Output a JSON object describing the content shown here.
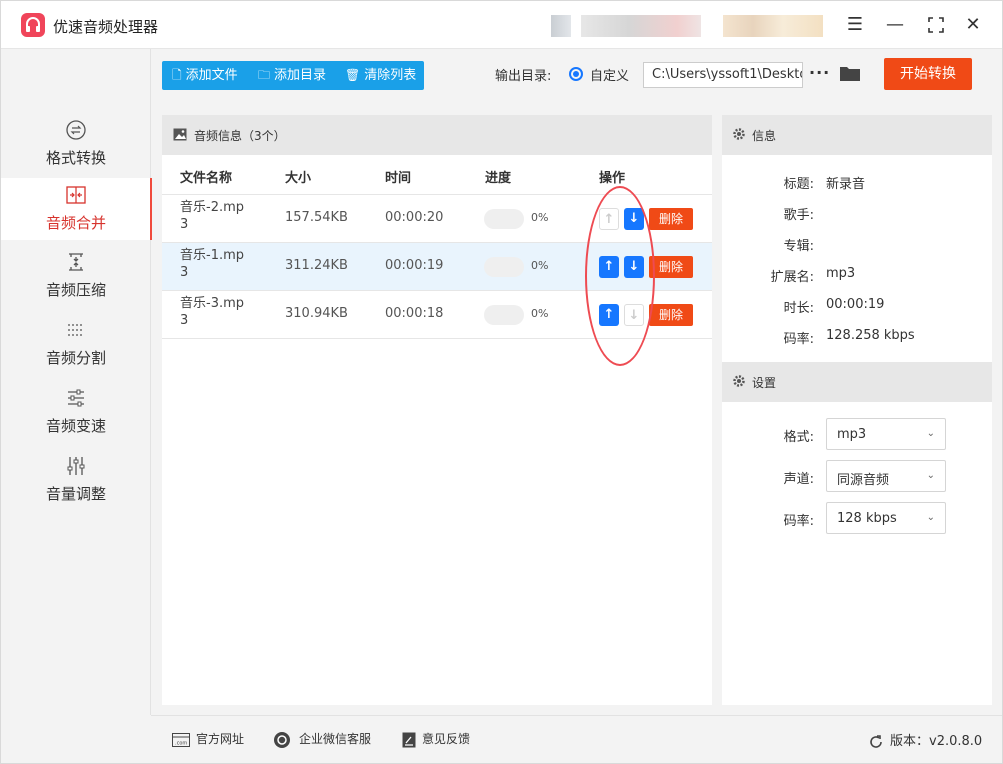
{
  "app": {
    "title": "优速音频处理器"
  },
  "sidebar": {
    "items": [
      {
        "label": "格式转换",
        "icon": "swap-circle-icon",
        "active": false
      },
      {
        "label": "音频合并",
        "icon": "merge-icon",
        "active": true
      },
      {
        "label": "音频压缩",
        "icon": "compress-icon",
        "active": false
      },
      {
        "label": "音频分割",
        "icon": "split-icon",
        "active": false
      },
      {
        "label": "音频变速",
        "icon": "speed-sliders-icon",
        "active": false
      },
      {
        "label": "音量调整",
        "icon": "volume-sliders-icon",
        "active": false
      }
    ]
  },
  "toolbar": {
    "add_file": "添加文件",
    "add_dir": "添加目录",
    "clear_list": "清除列表",
    "output_label": "输出目录:",
    "output_option": "自定义",
    "output_path": "C:\\Users\\yssoft1\\Deskto",
    "more": "···",
    "start": "开始转换"
  },
  "file_panel": {
    "title": "音频信息（3个）",
    "columns": [
      "文件名称",
      "大小",
      "时间",
      "进度",
      "操作"
    ],
    "rows": [
      {
        "name_l1": "音乐-2.mp",
        "name_l2": "3",
        "size": "157.54KB",
        "time": "00:00:20",
        "progress": 0,
        "progress_text": "0%",
        "up_enabled": false,
        "down_enabled": true,
        "delete": "删除"
      },
      {
        "name_l1": "音乐-1.mp",
        "name_l2": "3",
        "size": "311.24KB",
        "time": "00:00:19",
        "progress": 0,
        "progress_text": "0%",
        "up_enabled": true,
        "down_enabled": true,
        "delete": "删除"
      },
      {
        "name_l1": "音乐-3.mp",
        "name_l2": "3",
        "size": "310.94KB",
        "time": "00:00:18",
        "progress": 0,
        "progress_text": "0%",
        "up_enabled": true,
        "down_enabled": false,
        "delete": "删除"
      }
    ]
  },
  "info": {
    "title": "信息",
    "fields": [
      {
        "label": "标题:",
        "value": "新录音"
      },
      {
        "label": "歌手:",
        "value": ""
      },
      {
        "label": "专辑:",
        "value": ""
      },
      {
        "label": "扩展名:",
        "value": "mp3"
      },
      {
        "label": "时长:",
        "value": "00:00:19"
      },
      {
        "label": "码率:",
        "value": "128.258 kbps"
      }
    ]
  },
  "settings": {
    "title": "设置",
    "fields": [
      {
        "label": "格式:",
        "value": "mp3"
      },
      {
        "label": "声道:",
        "value": "同源音频"
      },
      {
        "label": "码率:",
        "value": "128 kbps"
      }
    ]
  },
  "footer": {
    "website": "官方网址",
    "wechat": "企业微信客服",
    "feedback": "意见反馈",
    "version": "版本：v2.0.8.0"
  },
  "colors": {
    "accent_blue": "#1677ff",
    "toolbar_blue": "#1aa0e8",
    "orange": "#f04a16",
    "active_red": "#d7332d",
    "annotation": "#ee4b52"
  }
}
